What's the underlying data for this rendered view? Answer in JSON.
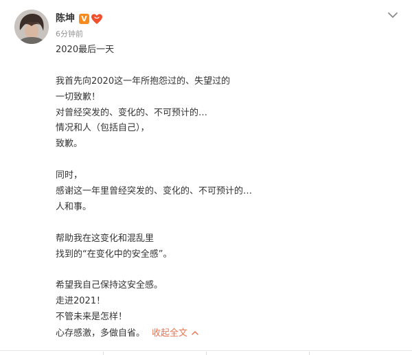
{
  "post": {
    "author": "陈坤",
    "verified_badge": "V",
    "time": "6分钟前",
    "lines": [
      "2020最后一天",
      "",
      "我首先向2020这一年所抱怨过的、失望过的",
      "一切致歉！",
      "对曾经突发的、变化的、不可预计的…",
      "情况和人（包括自己），",
      "致歉。",
      "",
      "同时，",
      "感谢这一年里曾经突发的、变化的、不可预计的…",
      "人和事。",
      "",
      "帮助我在这变化和混乱里",
      "找到的“在变化中的安全感”。",
      "",
      "希望我自己保持这安全感。",
      "走进2021！",
      "不管未来是怎样！"
    ],
    "last_line": "心存感激，多做自省。",
    "collapse_label": "收起全文"
  },
  "colors": {
    "text": "#333333",
    "meta": "#939393",
    "link": "#eb7350",
    "verified": "#f78b1f",
    "heart": "#f0512c"
  },
  "icons": {
    "menu": "chevron-down-icon",
    "collapse": "chevron-up-icon",
    "badge": "heart-badge-icon"
  }
}
